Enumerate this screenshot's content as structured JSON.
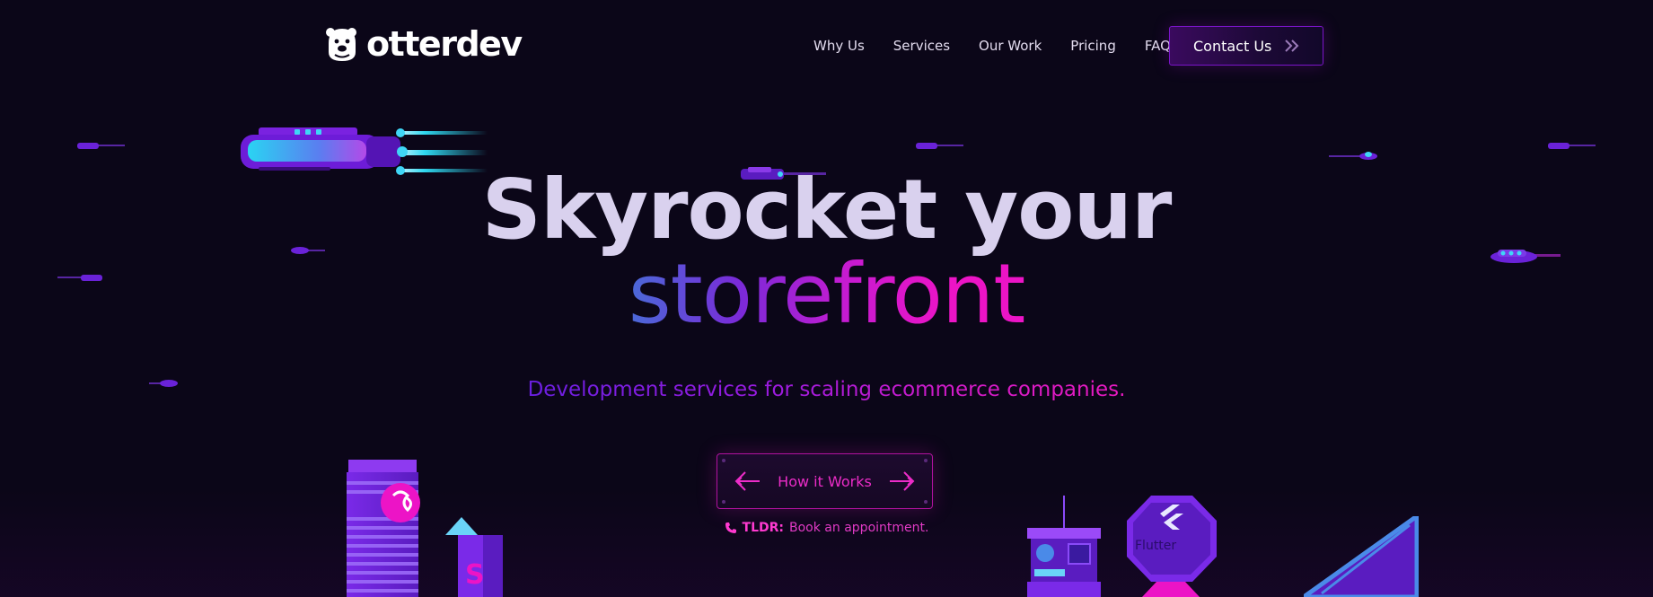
{
  "brand": {
    "name": "otterdev",
    "logo_icon": "otter-head-icon"
  },
  "nav": {
    "links": [
      "Why Us",
      "Services",
      "Our Work",
      "Pricing",
      "FAQ"
    ],
    "contact_label": "Contact Us",
    "contact_icon": "double-chevron-right-icon"
  },
  "hero": {
    "title_line1": "Skyrocket your",
    "title_line2": "storefront",
    "subtitle": "Development services for scaling ecommerce companies.",
    "cta_label": "How it Works",
    "tldr_label": "TLDR:",
    "tldr_text": "Book an appointment.",
    "tldr_icon": "phone-icon"
  },
  "colors": {
    "background": "#0b0618",
    "accent_pink": "#ec14c6",
    "accent_purple": "#7a14c8",
    "accent_blue": "#4a6ad8",
    "cyan": "#2fd8f0"
  },
  "decor": {
    "tech_logos": [
      "Flutter",
      "S"
    ]
  }
}
